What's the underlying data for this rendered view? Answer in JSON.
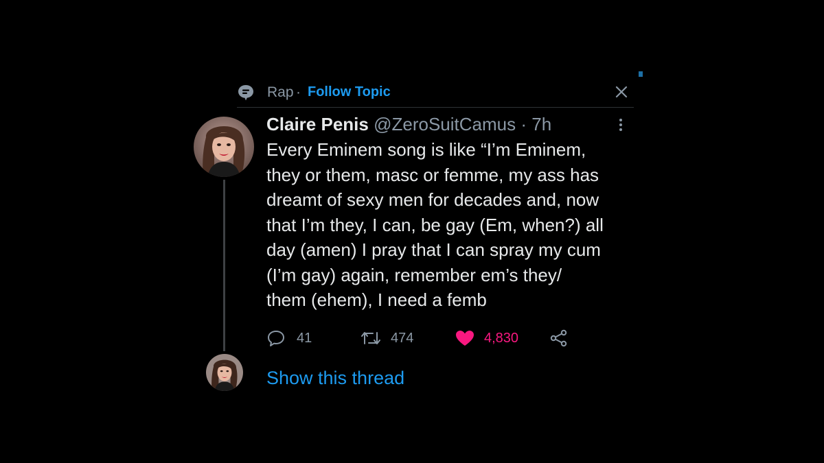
{
  "topic": {
    "name": "Rap",
    "separator": "·",
    "follow_label": "Follow Topic",
    "icon": "topic-bubble-icon"
  },
  "tweet": {
    "author_name": "Claire Penis",
    "handle": "@ZeroSuitCamus",
    "separator": "·",
    "time": "7h",
    "text_lines": [
      "Every Eminem song is like “I’m Eminem,",
      "they or them, masc or femme, my ass has",
      "dreamt of sexy men for decades and, now",
      "that I’m they, I can, be gay (Em, when?) all",
      "day (amen) I pray that I can spray my cum",
      "(I’m gay) again, remember em’s they/",
      "them (ehem), I need a femb"
    ],
    "replies": "41",
    "retweets": "474",
    "likes": "4,830"
  },
  "thread": {
    "show_label": "Show this thread"
  },
  "colors": {
    "background": "#000000",
    "accent": "#1d9bf0",
    "like": "#f91880",
    "secondary_text": "#8b98a5",
    "primary_text": "#e7e9ea"
  },
  "icons": [
    "topic-bubble-icon",
    "close-icon",
    "more-icon",
    "reply-icon",
    "retweet-icon",
    "like-icon",
    "share-icon"
  ]
}
